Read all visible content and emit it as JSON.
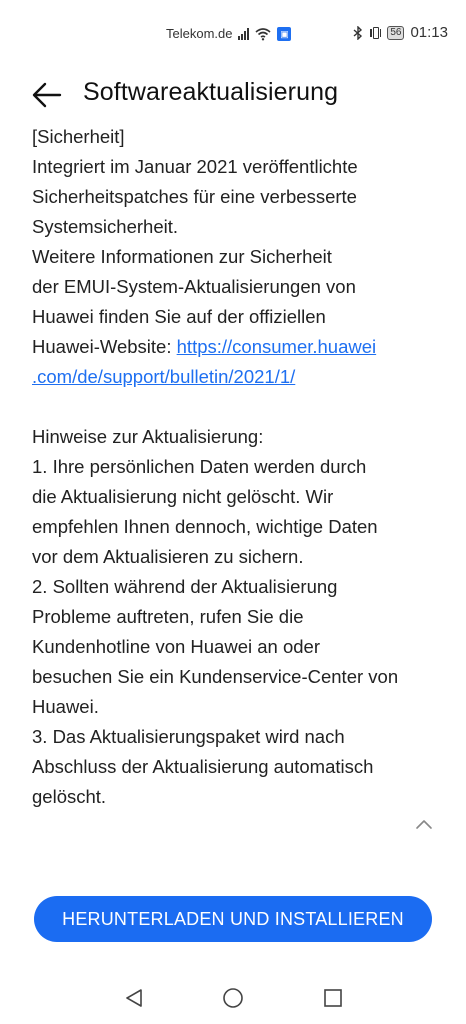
{
  "status_bar": {
    "carrier": "Telekom.de",
    "battery": "56",
    "time": "01:13"
  },
  "header": {
    "title": "Softwareaktualisierung"
  },
  "content": {
    "security_heading": "[Sicherheit]",
    "security_lines": [
      "Integriert im Januar 2021 veröffentlichte",
      "Sicherheitspatches für eine verbesserte",
      "Systemsicherheit.",
      "Weitere Informationen zur Sicherheit",
      "der EMUI-System-Aktualisierungen von",
      "Huawei finden Sie auf der offiziellen"
    ],
    "website_label": "Huawei-Website: ",
    "link_part1": "https://consumer.huawei",
    "link_part2": ".com/de/support/bulletin/2021/1/",
    "notes_heading": "Hinweise zur Aktualisierung:",
    "notes_lines": [
      "1. Ihre persönlichen Daten werden durch",
      "die Aktualisierung nicht gelöscht. Wir",
      "empfehlen Ihnen dennoch, wichtige Daten",
      "vor dem Aktualisieren zu sichern.",
      "2. Sollten während der Aktualisierung",
      "Probleme auftreten, rufen Sie die",
      "Kundenhotline von Huawei an oder",
      "besuchen Sie ein Kundenservice-Center von",
      "Huawei.",
      "3. Das Aktualisierungspaket wird nach",
      "Abschluss der Aktualisierung automatisch",
      "gelöscht."
    ]
  },
  "download_button": {
    "label": "HERUNTERLADEN UND INSTALLIEREN"
  },
  "colors": {
    "accent": "#1b6cf2",
    "link": "#1e6ff1"
  }
}
